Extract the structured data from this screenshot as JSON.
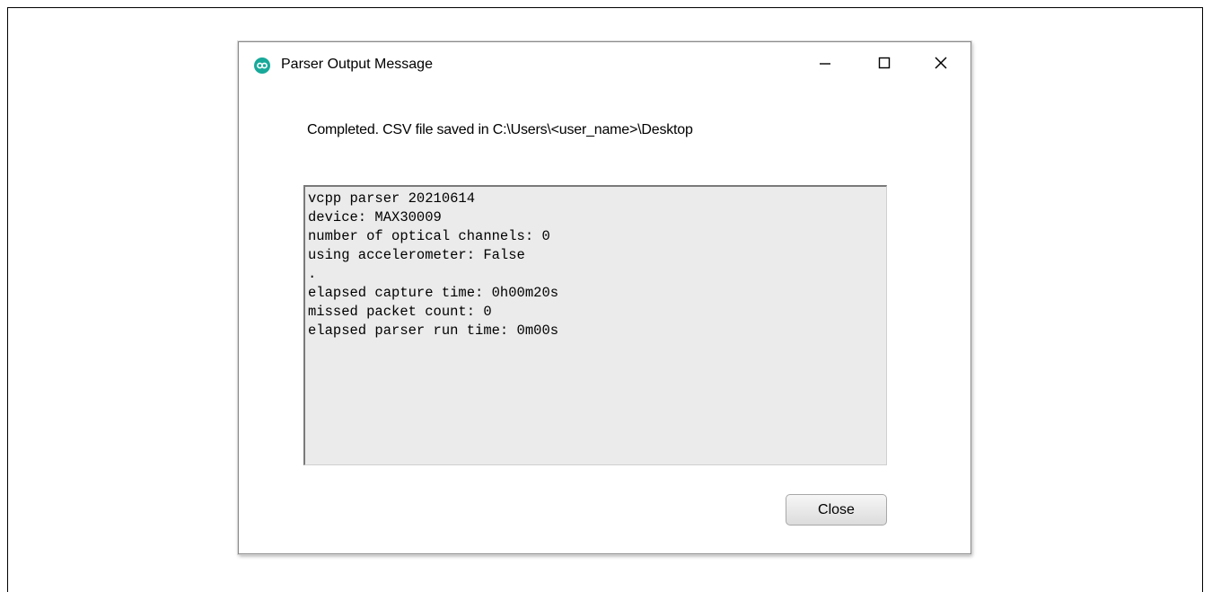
{
  "window": {
    "title": "Parser Output Message",
    "icon": "maxim-logo-icon",
    "controls": {
      "minimize": "minimize-icon",
      "maximize": "maximize-icon",
      "close": "close-icon"
    }
  },
  "message": "Completed. CSV file saved in C:\\Users\\<user_name>\\Desktop",
  "output": {
    "lines": "vcpp parser 20210614\ndevice: MAX30009\nnumber of optical channels: 0\nusing accelerometer: False\n.\nelapsed capture time: 0h00m20s\nmissed packet count: 0\nelapsed parser run time: 0m00s"
  },
  "buttons": {
    "close_label": "Close"
  },
  "colors": {
    "icon_accent": "#18a99a",
    "output_background": "#ebebeb"
  }
}
